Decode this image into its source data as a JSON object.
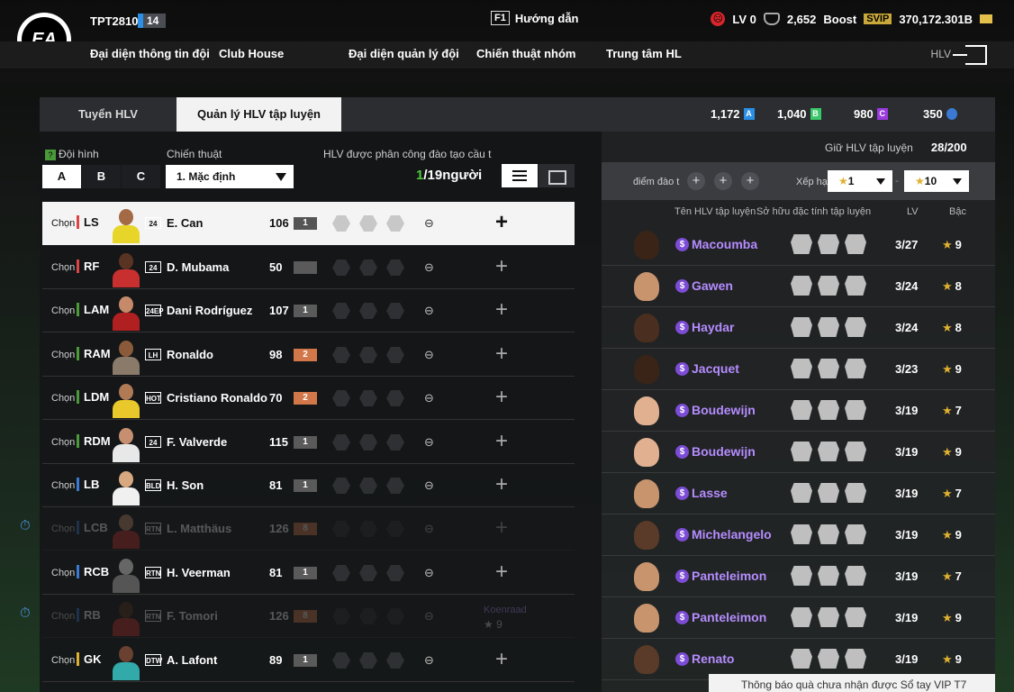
{
  "header": {
    "username": "TPT2810",
    "user_level": "14",
    "guide_key": "F1",
    "guide_label": "Hướng dẫn",
    "lv": "LV 0",
    "points": "2,652",
    "boost": "Boost",
    "svip": "SVIP",
    "bp": "370,172.301B",
    "nav": [
      "Đại diện thông tin đội",
      "Club House",
      "Đại diện quản lý đội",
      "Chiến thuật nhóm",
      "Trung tâm HL"
    ],
    "hlv": "HLV",
    "logo_text": "EA"
  },
  "tabs": {
    "recruit": "Tuyển HLV",
    "manage": "Quản lý HLV tập luyện"
  },
  "currencies": [
    {
      "value": "1,172",
      "letter": "A",
      "color": "#2a8fe6"
    },
    {
      "value": "1,040",
      "letter": "B",
      "color": "#3ac86a"
    },
    {
      "value": "980",
      "letter": "C",
      "color": "#9a3ae0"
    },
    {
      "value": "350",
      "letter": "",
      "color": "#3a7ad4"
    }
  ],
  "left": {
    "formation_label": "Đội hình",
    "tactic_label": "Chiến thuật",
    "assign_label": "HLV được phân công đào tạo cầu t",
    "sets": [
      "A",
      "B",
      "C"
    ],
    "tactic_value": "1. Mặc định",
    "assigned": "1",
    "assign_total": "/19người",
    "chon": "Chọn",
    "players": [
      {
        "pos": "LS",
        "season": "24",
        "name": "E. Can",
        "ovr": "106",
        "level": "1",
        "skin": "#a36a45",
        "kit": "#e8d52a",
        "line": "att"
      },
      {
        "pos": "RF",
        "season": "24",
        "name": "D. Mubama",
        "ovr": "50",
        "level": "",
        "skin": "#5a3423",
        "kit": "#c83030",
        "line": "att"
      },
      {
        "pos": "LAM",
        "season": "24EP",
        "name": "Dani Rodríguez",
        "ovr": "107",
        "level": "1",
        "skin": "#c68a6a",
        "kit": "#b02020",
        "line": "mid"
      },
      {
        "pos": "RAM",
        "season": "LH",
        "name": "Ronaldo",
        "ovr": "98",
        "level": "2",
        "skin": "#8a5a3a",
        "kit": "#8a7a6a",
        "line": "mid"
      },
      {
        "pos": "LDM",
        "season": "HOT",
        "name": "Cristiano Ronaldo",
        "ovr": "70",
        "level": "2",
        "skin": "#b07a55",
        "kit": "#e8c82a",
        "line": "mid"
      },
      {
        "pos": "RDM",
        "season": "24",
        "name": "F. Valverde",
        "ovr": "115",
        "level": "1",
        "skin": "#c69070",
        "kit": "#e8e8e8",
        "line": "mid"
      },
      {
        "pos": "LB",
        "season": "BLD",
        "name": "H. Son",
        "ovr": "81",
        "level": "1",
        "skin": "#d8a880",
        "kit": "#f0f0f0",
        "line": "def"
      },
      {
        "pos": "LCB",
        "season": "RTN",
        "name": "L. Matthäus",
        "ovr": "126",
        "level": "8",
        "skin": "#c89070",
        "kit": "#c83030",
        "line": "def"
      },
      {
        "pos": "RCB",
        "season": "RTN",
        "name": "H. Veerman",
        "ovr": "81",
        "level": "1",
        "skin": "#666",
        "kit": "#555",
        "line": "def"
      },
      {
        "pos": "RB",
        "season": "RTN",
        "name": "F. Tomori",
        "ovr": "126",
        "level": "8",
        "skin": "#5a3423",
        "kit": "#c83030",
        "line": "def"
      },
      {
        "pos": "GK",
        "season": "DTW",
        "name": "A. Lafont",
        "ovr": "89",
        "level": "1",
        "skin": "#6a4030",
        "kit": "#3aa",
        "line": "gk"
      }
    ],
    "rb_coach_name": "Koenraad",
    "rb_coach_rank": "9"
  },
  "right": {
    "keep_label": "Giữ HLV tập luyện",
    "keep_value": "28/200",
    "train_label": "điểm đào t",
    "sort_label": "Xếp hạ",
    "sort_from": "1",
    "sort_to": "10",
    "col_name": "Tên HLV tập luyện",
    "col_trait": "Sở hữu đặc tính tập luyện",
    "col_lv": "LV",
    "col_rank": "Bậc",
    "coaches": [
      {
        "name": "Macoumba",
        "lv": "3/27",
        "rank": "9",
        "skin": "#3a2418"
      },
      {
        "name": "Gawen",
        "lv": "3/24",
        "rank": "8",
        "skin": "#c8946e"
      },
      {
        "name": "Haydar",
        "lv": "3/24",
        "rank": "8",
        "skin": "#4a2e20"
      },
      {
        "name": "Jacquet",
        "lv": "3/23",
        "rank": "9",
        "skin": "#3a2418"
      },
      {
        "name": "Boudewijn",
        "lv": "3/19",
        "rank": "7",
        "skin": "#e0b090"
      },
      {
        "name": "Boudewijn",
        "lv": "3/19",
        "rank": "9",
        "skin": "#e0b090"
      },
      {
        "name": "Lasse",
        "lv": "3/19",
        "rank": "7",
        "skin": "#c8946e"
      },
      {
        "name": "Michelangelo",
        "lv": "3/19",
        "rank": "9",
        "skin": "#5a3a28"
      },
      {
        "name": "Panteleimon",
        "lv": "3/19",
        "rank": "7",
        "skin": "#c8946e"
      },
      {
        "name": "Panteleimon",
        "lv": "3/19",
        "rank": "9",
        "skin": "#c8946e"
      },
      {
        "name": "Renato",
        "lv": "3/19",
        "rank": "9",
        "skin": "#5a3a28"
      }
    ]
  },
  "toast": "Thông báo quà chưa nhận được Sổ tay VIP T7"
}
